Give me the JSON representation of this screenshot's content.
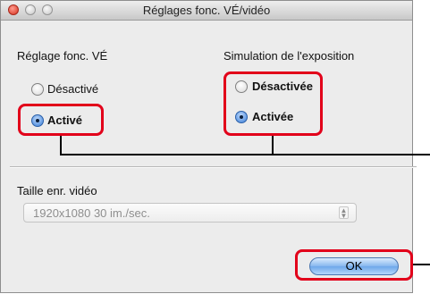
{
  "window": {
    "title": "Réglages fonc. VÉ/vidéo",
    "controls": [
      "close-icon",
      "minimize-icon",
      "zoom-icon"
    ]
  },
  "live_view": {
    "label": "Réglage fonc. VÉ",
    "options": [
      {
        "label": "Désactivé",
        "selected": false
      },
      {
        "label": "Activé",
        "selected": true
      }
    ]
  },
  "exposure_sim": {
    "label": "Simulation de l'exposition",
    "options": [
      {
        "label": "Désactivée",
        "selected": false
      },
      {
        "label": "Activée",
        "selected": true
      }
    ]
  },
  "video_size": {
    "label": "Taille enr. vidéo",
    "value": "1920x1080 30 im./sec.",
    "enabled": false
  },
  "buttons": {
    "ok": "OK"
  },
  "colors": {
    "highlight": "#e2001a",
    "accent": "#3c7fd8"
  }
}
